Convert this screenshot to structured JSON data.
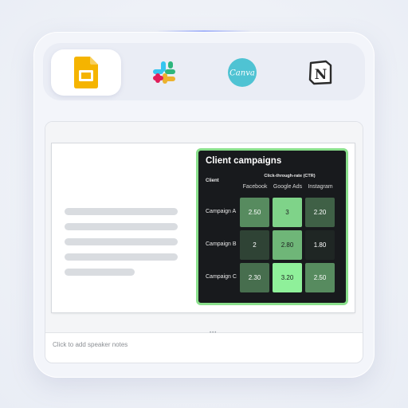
{
  "apps": [
    {
      "name": "Google Slides",
      "icon": "google-slides-icon",
      "active": true
    },
    {
      "name": "Slack",
      "icon": "slack-icon",
      "active": false
    },
    {
      "name": "Canva",
      "icon": "canva-icon",
      "label": "Canva",
      "active": false
    },
    {
      "name": "Notion",
      "icon": "notion-icon",
      "label": "N",
      "active": false
    }
  ],
  "slide": {
    "chart": {
      "title": "Client campaigns",
      "subtitle": "Click-through-rate (CTR)",
      "row_header": "Client",
      "columns": [
        "Facebook",
        "Google Ads",
        "Instagram"
      ],
      "rows": [
        {
          "label": "Campaign A",
          "cells": [
            "2.50",
            "3",
            "2.20"
          ]
        },
        {
          "label": "Campaign B",
          "cells": [
            "2",
            "2.80",
            "1.80"
          ]
        },
        {
          "label": "Campaign C",
          "cells": [
            "2.30",
            "3.20",
            "2.50"
          ]
        }
      ]
    }
  },
  "notes": {
    "placeholder": "Click to add speaker notes"
  },
  "colors": {
    "chart_border": "#8ae08c",
    "chart_background": "#181a1d",
    "heat_high": "#8ff09a",
    "heat_low": "#1f2624"
  },
  "chart_data": {
    "type": "heatmap",
    "title": "Client campaigns",
    "subtitle": "Click-through-rate (CTR)",
    "x": [
      "Facebook",
      "Google Ads",
      "Instagram"
    ],
    "y": [
      "Campaign A",
      "Campaign B",
      "Campaign C"
    ],
    "values": [
      [
        2.5,
        3.0,
        2.2
      ],
      [
        2.0,
        2.8,
        1.8
      ],
      [
        2.3,
        3.2,
        2.5
      ]
    ],
    "ylabel": "Client"
  }
}
